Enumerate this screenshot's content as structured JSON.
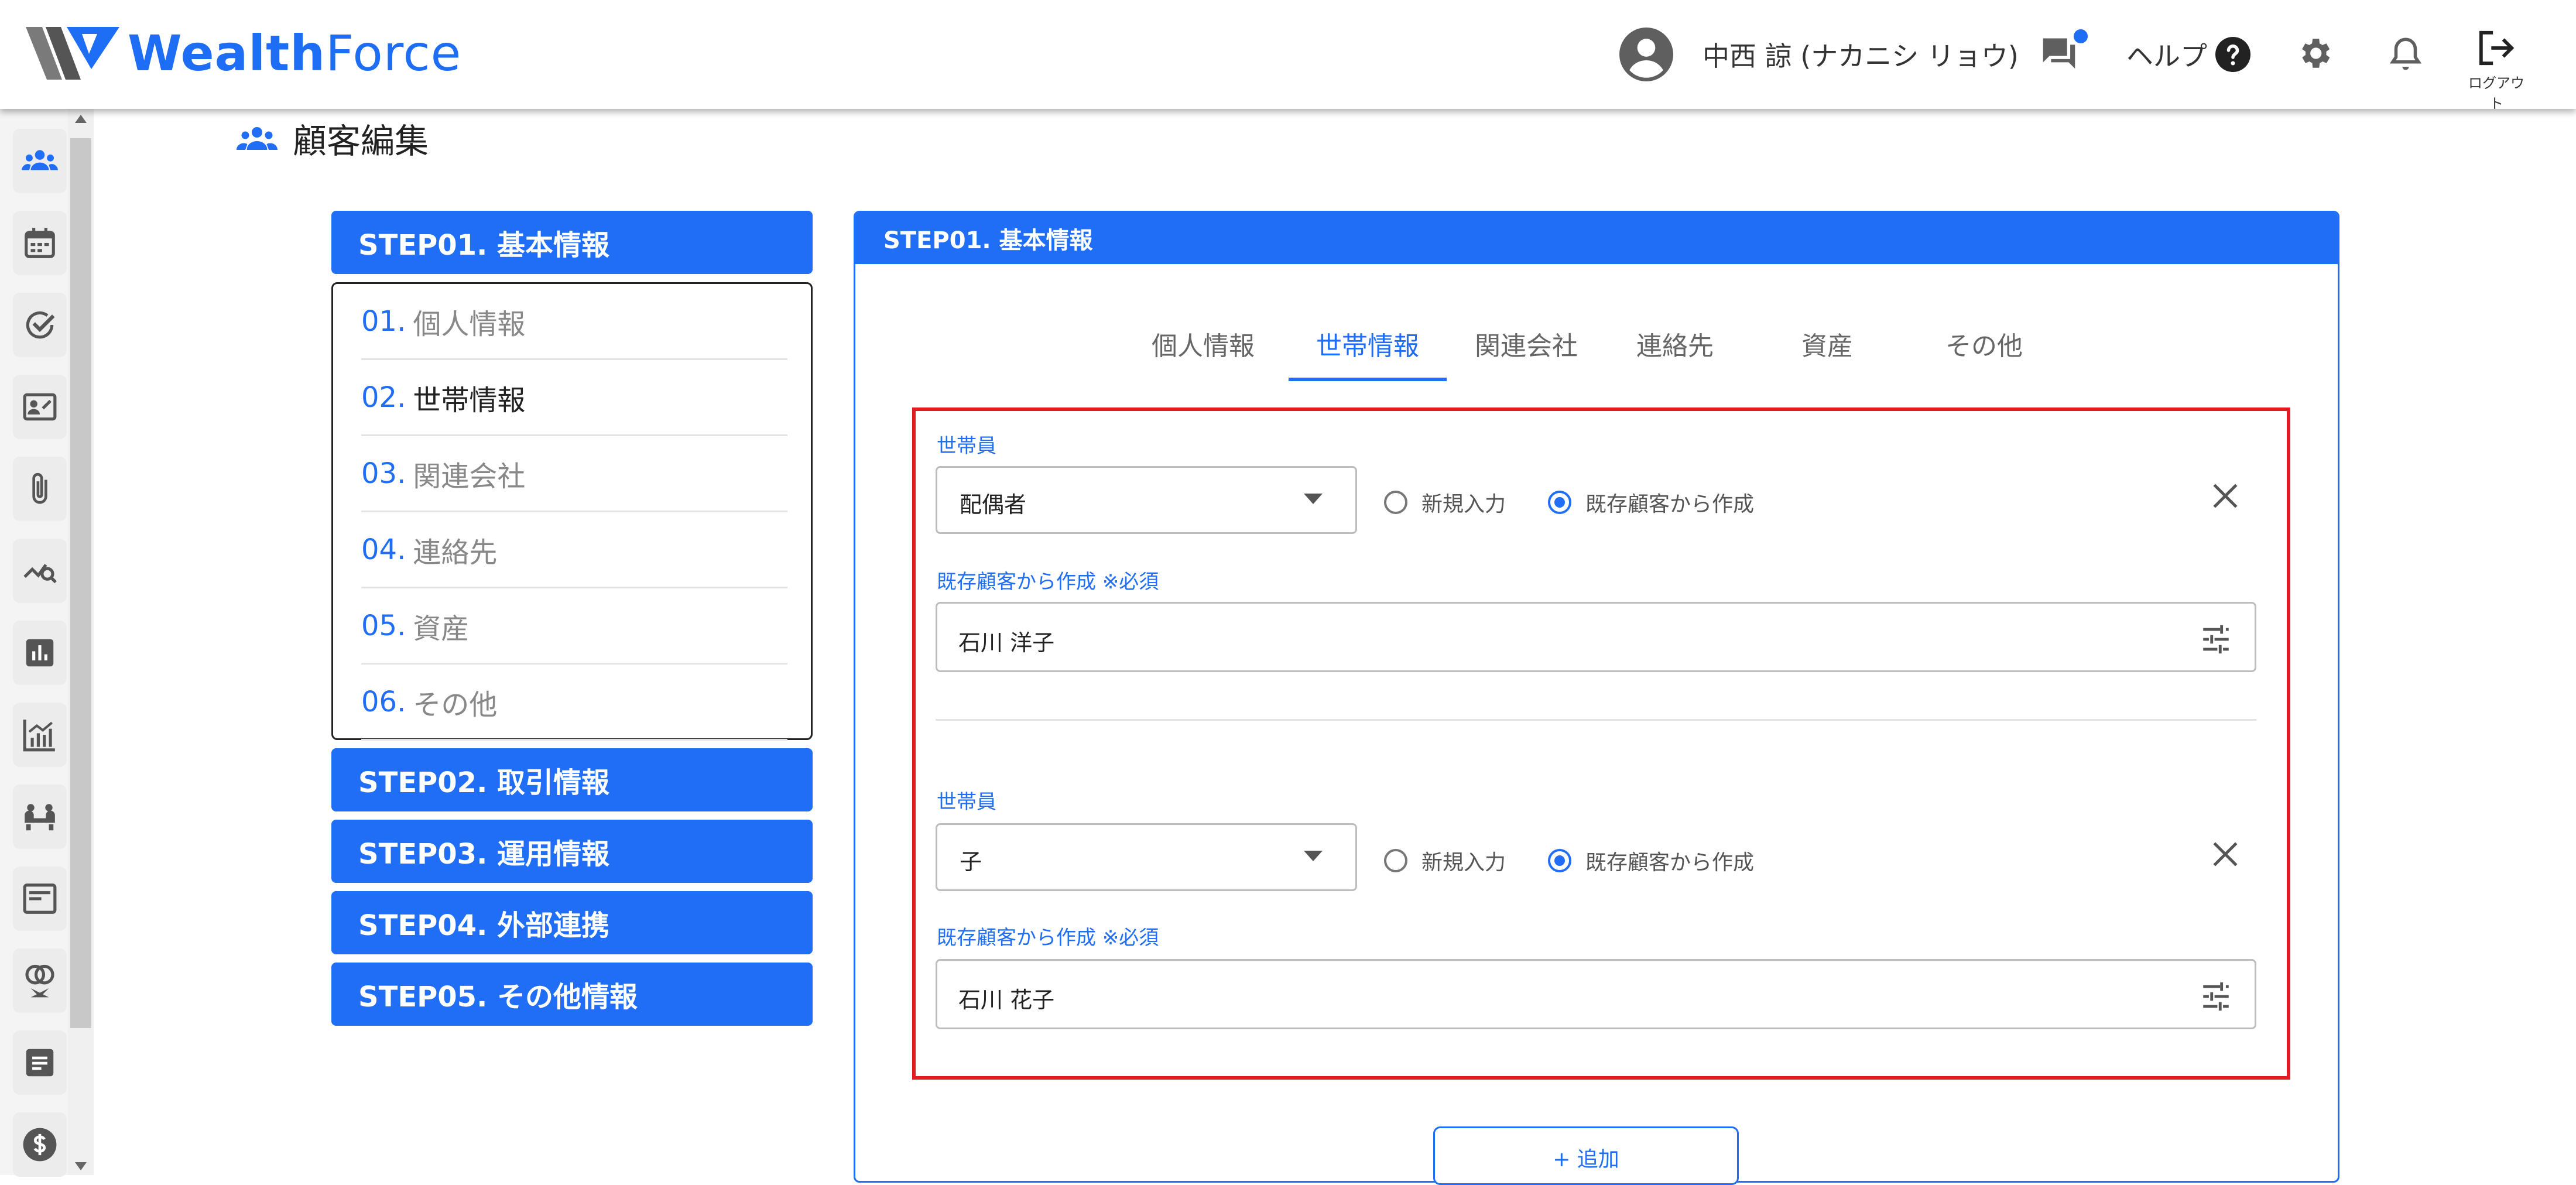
{
  "header": {
    "logo_text_a": "Wealth",
    "logo_text_b": "Force",
    "user_name": "中西 諒 (ナカニシ リョウ)",
    "help_label": "ヘルプ",
    "logout_label": "ログアウト",
    "icons": [
      "account-circle-icon",
      "chat-icon",
      "help-icon",
      "gear-icon",
      "bell-icon",
      "logout-icon"
    ],
    "accent_color": "#1f6ef5"
  },
  "sidebar": {
    "icons": [
      "people-icon",
      "calendar-icon",
      "check-circle-icon",
      "contact-card-icon",
      "paperclip-icon",
      "chart-search-icon",
      "bar-chart-icon",
      "analytics-icon",
      "meeting-icon",
      "article-icon",
      "rings-icon",
      "note-icon",
      "dollar-icon"
    ]
  },
  "page": {
    "title": "顧客編集"
  },
  "steps": {
    "step1": "STEP01. 基本情報",
    "step2": "STEP02. 取引情報",
    "step3": "STEP03. 運用情報",
    "step4": "STEP04. 外部連携",
    "step5": "STEP05. その他情報",
    "sub_items": [
      {
        "num": "01.",
        "label": "個人情報"
      },
      {
        "num": "02.",
        "label": "世帯情報"
      },
      {
        "num": "03.",
        "label": "関連会社"
      },
      {
        "num": "04.",
        "label": "連絡先"
      },
      {
        "num": "05.",
        "label": "資産"
      },
      {
        "num": "06.",
        "label": "その他"
      }
    ]
  },
  "panel": {
    "title": "STEP01. 基本情報",
    "tabs": [
      "個人情報",
      "世帯情報",
      "関連会社",
      "連絡先",
      "資産",
      "その他"
    ],
    "active_tab": "世帯情報",
    "members": [
      {
        "label": "世帯員",
        "relation": "配偶者",
        "radio_new": "新規入力",
        "radio_existing": "既存顧客から作成",
        "selected": "既存顧客から作成",
        "existing_label": "既存顧客から作成 ※必須",
        "existing_value": "石川 洋子"
      },
      {
        "label": "世帯員",
        "relation": "子",
        "radio_new": "新規入力",
        "radio_existing": "既存顧客から作成",
        "selected": "既存顧客から作成",
        "existing_label": "既存顧客から作成 ※必須",
        "existing_value": "石川 花子"
      }
    ],
    "add_button": "+ 追加",
    "highlight_color": "#e31b23"
  }
}
